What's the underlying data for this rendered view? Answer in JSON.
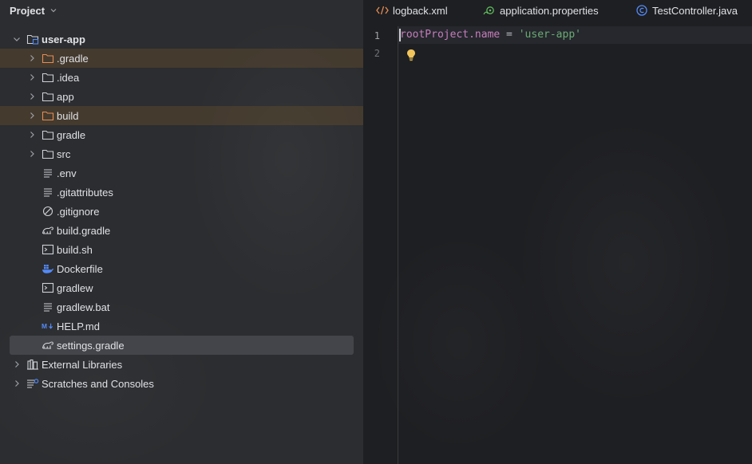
{
  "project_panel": {
    "title": "Project",
    "tree": [
      {
        "label": "user-app",
        "icon": "module-folder-icon",
        "arrow": "expanded",
        "level": 0,
        "bold": true
      },
      {
        "label": ".gradle",
        "icon": "folder-excluded-icon",
        "arrow": "collapsed",
        "level": 1,
        "excluded": true
      },
      {
        "label": ".idea",
        "icon": "folder-icon",
        "arrow": "collapsed",
        "level": 1
      },
      {
        "label": "app",
        "icon": "folder-icon",
        "arrow": "collapsed",
        "level": 1
      },
      {
        "label": "build",
        "icon": "folder-excluded-icon",
        "arrow": "collapsed",
        "level": 1,
        "excluded": true
      },
      {
        "label": "gradle",
        "icon": "folder-icon",
        "arrow": "collapsed",
        "level": 1
      },
      {
        "label": "src",
        "icon": "folder-icon",
        "arrow": "collapsed",
        "level": 1
      },
      {
        "label": ".env",
        "icon": "text-file-icon",
        "level": 1
      },
      {
        "label": ".gitattributes",
        "icon": "text-file-icon",
        "level": 1
      },
      {
        "label": ".gitignore",
        "icon": "ignore-file-icon",
        "level": 1
      },
      {
        "label": "build.gradle",
        "icon": "gradle-elephant-icon",
        "level": 1
      },
      {
        "label": "build.sh",
        "icon": "shell-script-icon",
        "level": 1
      },
      {
        "label": "Dockerfile",
        "icon": "docker-whale-icon",
        "level": 1
      },
      {
        "label": "gradlew",
        "icon": "shell-script-icon",
        "level": 1
      },
      {
        "label": "gradlew.bat",
        "icon": "text-file-icon",
        "level": 1
      },
      {
        "label": "HELP.md",
        "icon": "markdown-icon",
        "level": 1
      },
      {
        "label": "settings.gradle",
        "icon": "gradle-elephant-icon",
        "level": 1,
        "selected": true
      },
      {
        "label": "External Libraries",
        "icon": "libraries-icon",
        "arrow": "collapsed",
        "level": 0
      },
      {
        "label": "Scratches and Consoles",
        "icon": "scratches-icon",
        "arrow": "collapsed",
        "level": 0
      }
    ]
  },
  "editor": {
    "tabs": [
      {
        "label": "logback.xml",
        "icon": "xml-tag-icon"
      },
      {
        "label": "application.properties",
        "icon": "spring-properties-icon"
      },
      {
        "label": "TestController.java",
        "icon": "java-class-icon"
      }
    ],
    "line_numbers": [
      "1",
      "2"
    ],
    "code_line_1": {
      "prop": "rootProject.name",
      "op": " = ",
      "str": "'user-app'"
    }
  },
  "colors": {
    "excluded_row": "#855f2a",
    "selected_row": "#43454a",
    "string": "#6aab73",
    "property": "#c77dbb",
    "accent_blue": "#548af7"
  }
}
